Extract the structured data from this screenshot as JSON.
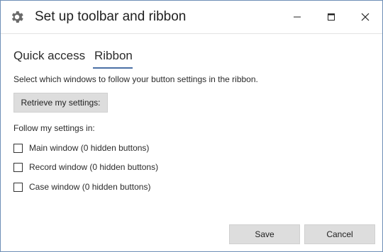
{
  "window": {
    "title": "Set up toolbar and ribbon",
    "icon": "gear-icon",
    "controls": [
      "minimize-icon",
      "maximize-icon",
      "close-icon"
    ]
  },
  "tabs": [
    {
      "label": "Quick access",
      "selected": false
    },
    {
      "label": "Ribbon",
      "selected": true
    }
  ],
  "main": {
    "description": "Select which windows to follow your button settings in the ribbon.",
    "retrieve_label": "Retrieve my settings:",
    "follow_label": "Follow my settings in:",
    "options": [
      {
        "label": "Main window (0 hidden buttons)",
        "checked": false
      },
      {
        "label": "Record window (0 hidden buttons)",
        "checked": false
      },
      {
        "label": "Case window (0 hidden buttons)",
        "checked": false
      }
    ]
  },
  "footer": {
    "save_label": "Save",
    "cancel_label": "Cancel"
  },
  "colors": {
    "accent": "#4a6fa5",
    "button_bg": "#dddddd",
    "border": "#6e8fb6"
  }
}
